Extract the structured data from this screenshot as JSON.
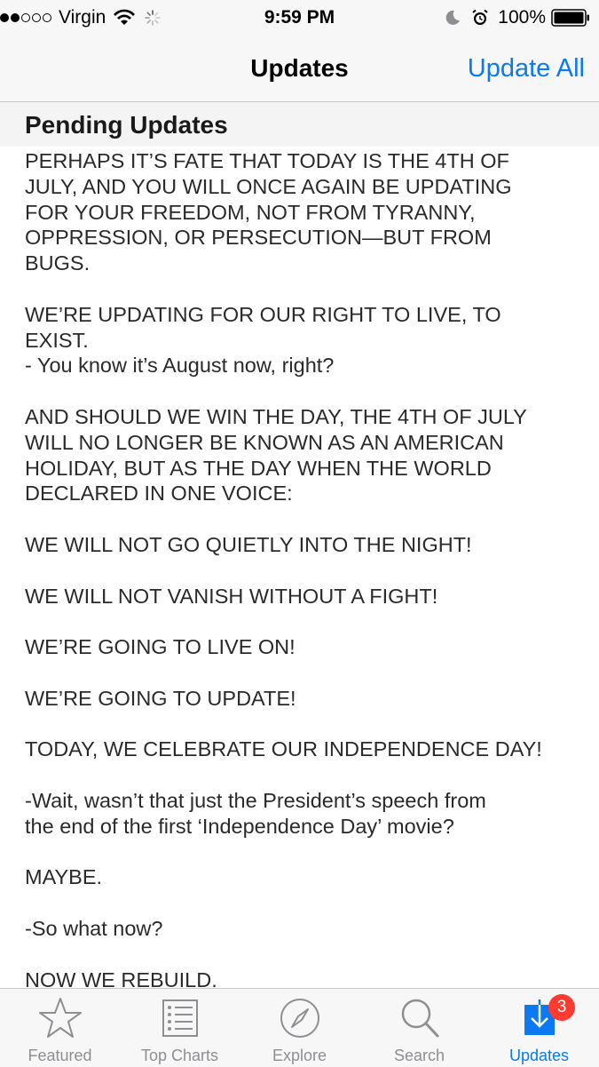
{
  "status_bar": {
    "carrier": "Virgin",
    "time": "9:59 PM",
    "battery_percent": "100%",
    "signal_bars_filled": 2,
    "signal_bars_total": 5
  },
  "nav": {
    "title": "Updates",
    "action_label": "Update All"
  },
  "section": {
    "title": "Pending Updates"
  },
  "release_notes": [
    "PERHAPS IT’S FATE THAT TODAY IS THE 4TH OF\nJULY, AND YOU WILL ONCE AGAIN BE UPDATING\nFOR YOUR FREEDOM, NOT FROM TYRANNY,\nOPPRESSION, OR PERSECUTION—BUT FROM\nBUGS.",
    "WE’RE UPDATING FOR OUR RIGHT TO LIVE, TO\nEXIST.\n- You know it’s August now, right?",
    "AND SHOULD WE WIN THE DAY, THE 4TH OF JULY\nWILL NO LONGER BE KNOWN AS AN AMERICAN\nHOLIDAY, BUT AS THE DAY WHEN THE WORLD\nDECLARED IN ONE VOICE:",
    "WE WILL NOT GO QUIETLY INTO THE NIGHT!",
    "WE WILL NOT VANISH WITHOUT A FIGHT!",
    "WE’RE GOING TO LIVE ON!",
    "WE’RE GOING TO UPDATE!",
    "TODAY, WE CELEBRATE OUR INDEPENDENCE DAY!",
    "-Wait, wasn’t that just the President’s speech from\nthe end of the first ‘Independence Day’ movie?",
    "MAYBE.",
    "-So what now?",
    "NOW WE REBUILD."
  ],
  "tabs": [
    {
      "label": "Featured",
      "icon": "star-icon",
      "active": false
    },
    {
      "label": "Top Charts",
      "icon": "list-icon",
      "active": false
    },
    {
      "label": "Explore",
      "icon": "compass-icon",
      "active": false
    },
    {
      "label": "Search",
      "icon": "search-icon",
      "active": false
    },
    {
      "label": "Updates",
      "icon": "download-icon",
      "active": true,
      "badge": "3"
    }
  ],
  "colors": {
    "accent": "#0a7af0",
    "inactive_tab": "#8e8e93",
    "badge": "#ff3b30"
  }
}
